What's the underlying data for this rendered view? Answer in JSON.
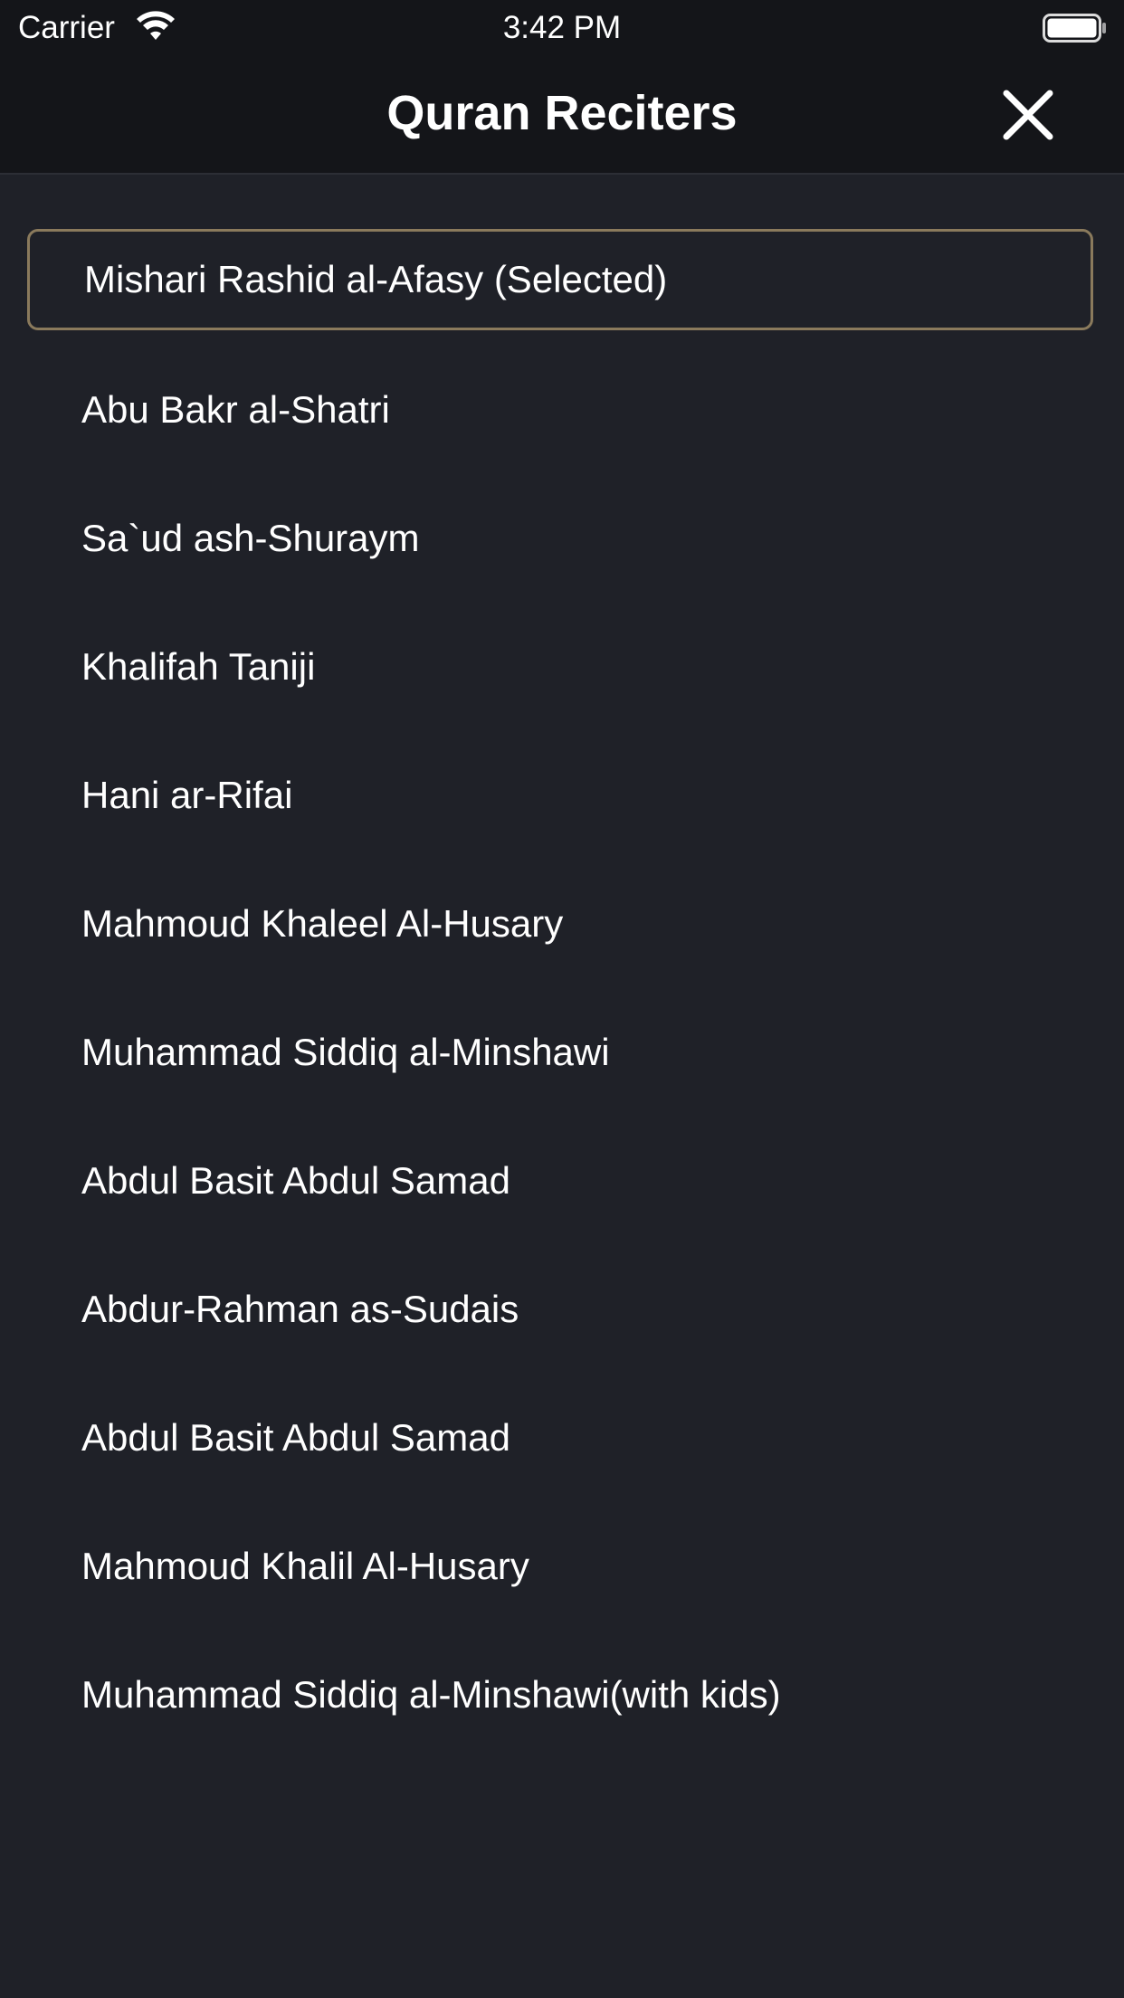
{
  "status_bar": {
    "carrier": "Carrier",
    "time": "3:42 PM",
    "icons": [
      "wifi-icon",
      "battery-icon"
    ]
  },
  "nav": {
    "title": "Quran Reciters",
    "close_icon": "close-icon"
  },
  "reciters": [
    {
      "label": "Mishari Rashid al-Afasy (Selected)",
      "selected": true
    },
    {
      "label": "Abu Bakr al-Shatri",
      "selected": false
    },
    {
      "label": "Sa`ud ash-Shuraym",
      "selected": false
    },
    {
      "label": "Khalifah Taniji",
      "selected": false
    },
    {
      "label": "Hani ar-Rifai",
      "selected": false
    },
    {
      "label": "Mahmoud Khaleel Al-Husary",
      "selected": false
    },
    {
      "label": "Muhammad Siddiq al-Minshawi",
      "selected": false
    },
    {
      "label": "Abdul Basit Abdul Samad",
      "selected": false
    },
    {
      "label": "Abdur-Rahman as-Sudais",
      "selected": false
    },
    {
      "label": "Abdul Basit Abdul Samad",
      "selected": false
    },
    {
      "label": "Mahmoud Khalil Al-Husary",
      "selected": false
    },
    {
      "label": "Muhammad Siddiq al-Minshawi(with kids)",
      "selected": false
    }
  ],
  "colors": {
    "background": "#1f2128",
    "bar_background": "#141519",
    "selected_border": "#8a7a5c",
    "text": "#ffffff"
  }
}
